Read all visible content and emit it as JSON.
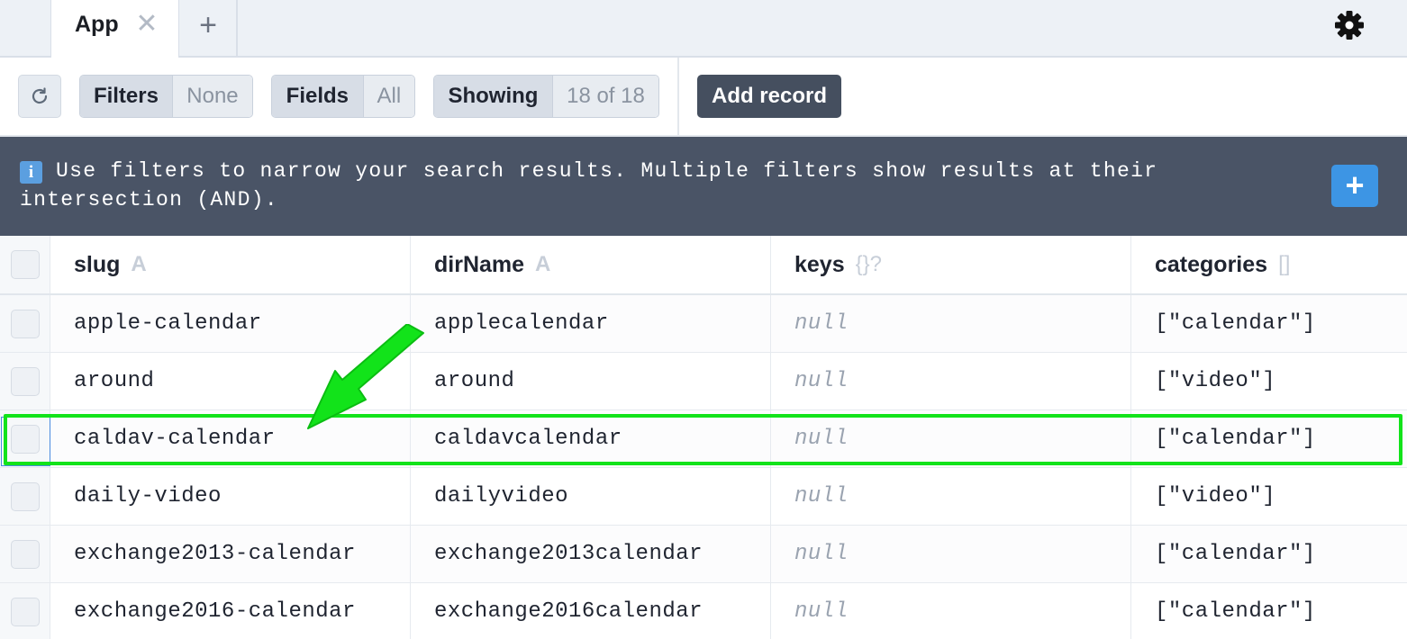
{
  "tabs": {
    "active_label": "App",
    "close_glyph": "✕",
    "add_glyph": "+",
    "settings_icon": "gear-icon"
  },
  "toolbar": {
    "refresh_icon": "refresh-icon",
    "filters": {
      "label": "Filters",
      "value": "None"
    },
    "fields": {
      "label": "Fields",
      "value": "All"
    },
    "showing": {
      "label": "Showing",
      "value": "18 of 18"
    },
    "add_record_label": "Add record"
  },
  "banner": {
    "info_glyph": "i",
    "text": "Use filters to narrow your search results. Multiple filters show results at their intersection (AND).",
    "add_glyph": "+"
  },
  "table": {
    "columns": [
      {
        "name": "slug",
        "type": "A"
      },
      {
        "name": "dirName",
        "type": "A"
      },
      {
        "name": "keys",
        "type": "{}?"
      },
      {
        "name": "categories",
        "type": "[]"
      }
    ],
    "rows": [
      {
        "slug": "apple-calendar",
        "dirName": "applecalendar",
        "keys": "null",
        "categories": "[\"calendar\"]"
      },
      {
        "slug": "around",
        "dirName": "around",
        "keys": "null",
        "categories": "[\"video\"]"
      },
      {
        "slug": "caldav-calendar",
        "dirName": "caldavcalendar",
        "keys": "null",
        "categories": "[\"calendar\"]"
      },
      {
        "slug": "daily-video",
        "dirName": "dailyvideo",
        "keys": "null",
        "categories": "[\"video\"]"
      },
      {
        "slug": "exchange2013-calendar",
        "dirName": "exchange2013calendar",
        "keys": "null",
        "categories": "[\"calendar\"]"
      },
      {
        "slug": "exchange2016-calendar",
        "dirName": "exchange2016calendar",
        "keys": "null",
        "categories": "[\"calendar\"]"
      }
    ]
  },
  "annotation": {
    "highlight_color": "#12e31a",
    "highlighted_row": 2
  }
}
